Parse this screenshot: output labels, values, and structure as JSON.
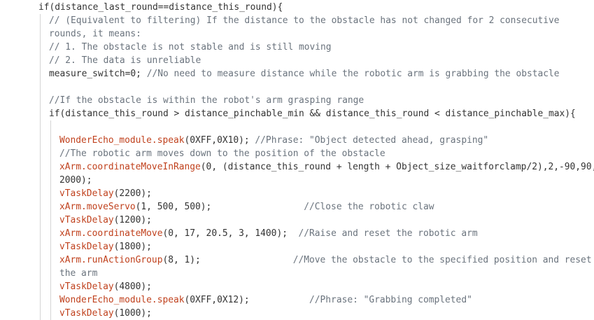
{
  "lines": [
    {
      "indent": 0,
      "parts": [
        {
          "t": "if(distance_last_round==distance_this_round){",
          "c": "kw-normal"
        }
      ]
    },
    {
      "indent": 1,
      "parts": [
        {
          "t": "// (Equivalent to filtering) If the distance to the obstacle has not changed for 2 consecutive",
          "c": "comment"
        }
      ]
    },
    {
      "indent": 1,
      "parts": [
        {
          "t": "rounds, it means:",
          "c": "comment"
        }
      ]
    },
    {
      "indent": 1,
      "parts": [
        {
          "t": "// 1. The obstacle is not stable and is still moving",
          "c": "comment"
        }
      ]
    },
    {
      "indent": 1,
      "parts": [
        {
          "t": "// 2. The data is unreliable",
          "c": "comment"
        }
      ]
    },
    {
      "indent": 1,
      "parts": [
        {
          "t": "measure_switch=0; ",
          "c": "kw-normal"
        },
        {
          "t": "//No need to measure distance while the robotic arm is grabbing the obstacle",
          "c": "comment"
        }
      ]
    },
    {
      "indent": 1,
      "parts": []
    },
    {
      "indent": 1,
      "parts": [
        {
          "t": "//If the obstacle is within the robot's arm grasping range",
          "c": "comment"
        }
      ]
    },
    {
      "indent": 1,
      "parts": [
        {
          "t": "if(distance_this_round > distance_pinchable_min && distance_this_round < distance_pinchable_max){",
          "c": "kw-normal"
        }
      ]
    },
    {
      "indent": 2,
      "parts": []
    },
    {
      "indent": 2,
      "parts": [
        {
          "t": "WonderEcho_module.speak",
          "c": "func"
        },
        {
          "t": "(0XFF,0X10); ",
          "c": "paren"
        },
        {
          "t": "//Phrase: \"Object detected ahead, grasping\"",
          "c": "comment"
        }
      ]
    },
    {
      "indent": 2,
      "parts": [
        {
          "t": "//The robotic arm moves down to the position of the obstacle",
          "c": "comment"
        }
      ]
    },
    {
      "indent": 2,
      "parts": [
        {
          "t": "xArm.coordinateMoveInRange",
          "c": "func"
        },
        {
          "t": "(0, (distance_this_round + length + Object_size_waitforclamp/2),2,-90,90,",
          "c": "paren"
        }
      ]
    },
    {
      "indent": 2,
      "parts": [
        {
          "t": "2000);",
          "c": "paren"
        }
      ]
    },
    {
      "indent": 2,
      "parts": [
        {
          "t": "vTaskDelay",
          "c": "func"
        },
        {
          "t": "(2200);",
          "c": "paren"
        }
      ]
    },
    {
      "indent": 2,
      "parts": [
        {
          "t": "xArm.moveServo",
          "c": "func"
        },
        {
          "t": "(1, 500, 500);",
          "c": "paren"
        },
        {
          "t": "                 ",
          "c": "paren"
        },
        {
          "t": "//Close the robotic claw",
          "c": "comment"
        }
      ]
    },
    {
      "indent": 2,
      "parts": [
        {
          "t": "vTaskDelay",
          "c": "func"
        },
        {
          "t": "(1200);",
          "c": "paren"
        }
      ]
    },
    {
      "indent": 2,
      "parts": [
        {
          "t": "xArm.coordinateMove",
          "c": "func"
        },
        {
          "t": "(0, 17, 20.5, 3, 1400);  ",
          "c": "paren"
        },
        {
          "t": "//Raise and reset the robotic arm",
          "c": "comment"
        }
      ]
    },
    {
      "indent": 2,
      "parts": [
        {
          "t": "vTaskDelay",
          "c": "func"
        },
        {
          "t": "(1800);",
          "c": "paren"
        }
      ]
    },
    {
      "indent": 2,
      "parts": [
        {
          "t": "xArm.runActionGroup",
          "c": "func"
        },
        {
          "t": "(8, 1);",
          "c": "paren"
        },
        {
          "t": "                 ",
          "c": "paren"
        },
        {
          "t": "//Move the obstacle to the specified position and reset",
          "c": "comment"
        }
      ]
    },
    {
      "indent": 2,
      "parts": [
        {
          "t": "the arm",
          "c": "comment"
        }
      ]
    },
    {
      "indent": 2,
      "parts": [
        {
          "t": "vTaskDelay",
          "c": "func"
        },
        {
          "t": "(4800);",
          "c": "paren"
        }
      ]
    },
    {
      "indent": 2,
      "parts": [
        {
          "t": "WonderEcho_module.speak",
          "c": "func"
        },
        {
          "t": "(0XFF,0X12);",
          "c": "paren"
        },
        {
          "t": "           ",
          "c": "paren"
        },
        {
          "t": "//Phrase: \"Grabbing completed\"",
          "c": "comment"
        }
      ]
    },
    {
      "indent": 2,
      "parts": [
        {
          "t": "vTaskDelay",
          "c": "func"
        },
        {
          "t": "(1000);",
          "c": "paren"
        }
      ]
    }
  ],
  "colors": {
    "background": "#ffffff",
    "text": "#333333",
    "function": "#c0411d",
    "comment": "#6a737d",
    "indent_guide": "#d4d4d4"
  }
}
